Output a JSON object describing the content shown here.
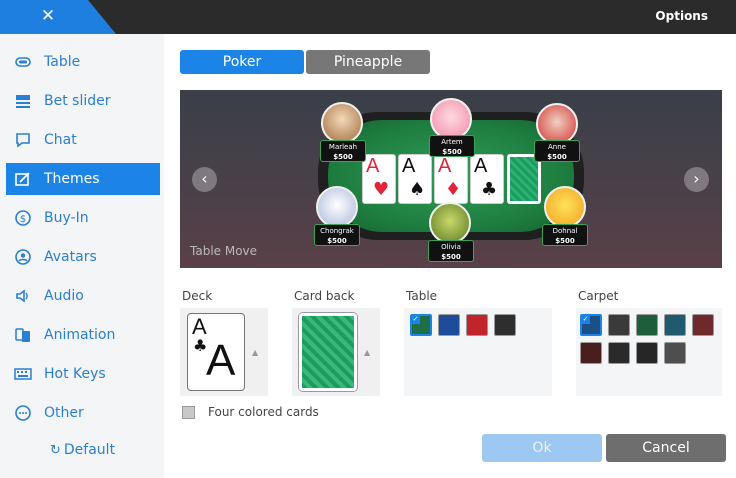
{
  "window": {
    "title": "Options",
    "close_icon": "close-icon"
  },
  "sidebar": {
    "items": [
      {
        "label": "Table",
        "icon": "table-icon"
      },
      {
        "label": "Bet slider",
        "icon": "bet-slider-icon"
      },
      {
        "label": "Chat",
        "icon": "chat-icon"
      },
      {
        "label": "Themes",
        "icon": "themes-icon",
        "active": true
      },
      {
        "label": "Buy-In",
        "icon": "buy-in-icon"
      },
      {
        "label": "Avatars",
        "icon": "avatars-icon"
      },
      {
        "label": "Audio",
        "icon": "audio-icon"
      },
      {
        "label": "Animation",
        "icon": "animation-icon"
      },
      {
        "label": "Hot Keys",
        "icon": "hot-keys-icon"
      },
      {
        "label": "Other",
        "icon": "other-icon"
      }
    ],
    "default_label": "Default"
  },
  "tabs": [
    {
      "label": "Poker",
      "active": true
    },
    {
      "label": "Pineapple",
      "active": false
    }
  ],
  "preview": {
    "caption": "Table Move",
    "players": [
      {
        "name": "Marleah",
        "stack": "$500"
      },
      {
        "name": "Artem",
        "stack": "$500"
      },
      {
        "name": "Anne",
        "stack": "$500"
      },
      {
        "name": "Chongrak",
        "stack": "$500"
      },
      {
        "name": "Olivia",
        "stack": "$500"
      },
      {
        "name": "Dohnal",
        "stack": "$500"
      }
    ],
    "board_cards": [
      {
        "rank": "A",
        "suit": "♥",
        "color": "#e0243a"
      },
      {
        "rank": "A",
        "suit": "♠",
        "color": "#111111"
      },
      {
        "rank": "A",
        "suit": "♦",
        "color": "#e0243a"
      },
      {
        "rank": "A",
        "suit": "♣",
        "color": "#111111"
      }
    ]
  },
  "sections": {
    "deck": {
      "label": "Deck",
      "rank": "A",
      "suit": "♣"
    },
    "card_back": {
      "label": "Card back"
    },
    "table": {
      "label": "Table",
      "colors": [
        "#1f6e4a",
        "#1d4c9a",
        "#c0252b",
        "#2e2e2e"
      ],
      "selected": 0
    },
    "carpet": {
      "label": "Carpet",
      "colors": [
        "#1c4f86",
        "#3a3a3a",
        "#1e5e3a",
        "#1f5a6e",
        "#6e2a2a",
        "#4a1e1e",
        "#2a2a2a",
        "#262626",
        "#4e4e4e"
      ],
      "selected": 0
    }
  },
  "four_colored_cards": {
    "label": "Four colored cards",
    "checked": false
  },
  "buttons": {
    "ok": "Ok",
    "cancel": "Cancel"
  },
  "accent_color": "#1c84e6"
}
